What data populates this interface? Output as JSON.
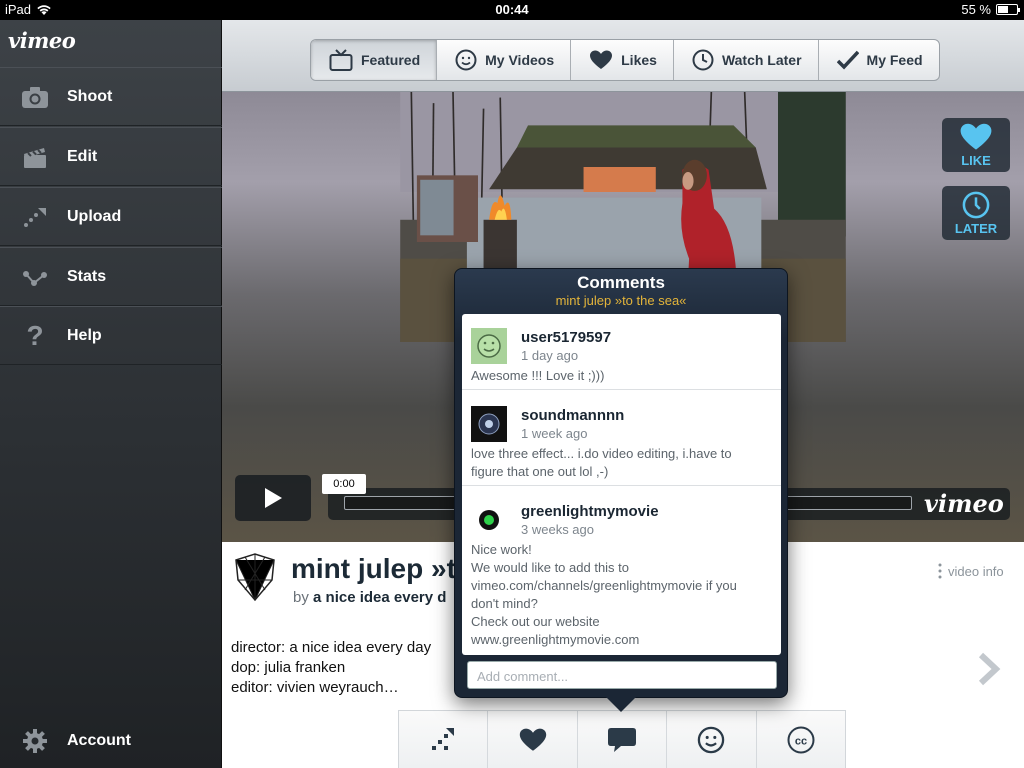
{
  "status_bar": {
    "device": "iPad",
    "time": "00:44",
    "battery_percent": "55 %",
    "battery_level": 0.55
  },
  "sidebar": {
    "logo": "vimeo",
    "items": [
      {
        "label": "Shoot",
        "icon": "camera-icon"
      },
      {
        "label": "Edit",
        "icon": "clapperboard-icon"
      },
      {
        "label": "Upload",
        "icon": "upload-icon"
      },
      {
        "label": "Stats",
        "icon": "stats-icon"
      },
      {
        "label": "Help",
        "icon": "help-icon"
      }
    ],
    "account": {
      "label": "Account",
      "icon": "gear-icon"
    }
  },
  "tabs": [
    {
      "label": "Featured",
      "icon": "tv-icon",
      "active": true
    },
    {
      "label": "My Videos",
      "icon": "smiley-icon",
      "active": false
    },
    {
      "label": "Likes",
      "icon": "heart-icon",
      "active": false
    },
    {
      "label": "Watch Later",
      "icon": "clock-icon",
      "active": false
    },
    {
      "label": "My Feed",
      "icon": "checkmark-icon",
      "active": false
    }
  ],
  "player": {
    "like_label": "LIKE",
    "later_label": "LATER",
    "current_time": "0:00",
    "watermark": "vimeo",
    "accent_color": "#58c4f0"
  },
  "video": {
    "title": "mint julep »to the sea«",
    "title_visible": "mint julep »t",
    "by_prefix": "by",
    "author_visible": "a nice idea every d",
    "info_label": "video info",
    "description": [
      "director: a nice idea every day",
      "dop: julia franken",
      "editor: vivien weyrauch…"
    ]
  },
  "actions": [
    {
      "name": "share",
      "icon": "share-icon"
    },
    {
      "name": "like",
      "icon": "heart-icon"
    },
    {
      "name": "comments",
      "icon": "speech-bubble-icon"
    },
    {
      "name": "user",
      "icon": "smiley-icon"
    },
    {
      "name": "captions",
      "icon": "cc-icon"
    }
  ],
  "comments": {
    "title": "Comments",
    "subtitle": "mint julep »to the sea«",
    "placeholder": "Add comment...",
    "subtitle_color": "#e3b43a",
    "items": [
      {
        "user": "user5179597",
        "time": "1 day ago",
        "lines": [
          "Awesome !!! Love it ;)))"
        ]
      },
      {
        "user": "soundmannnn",
        "time": "1 week ago",
        "lines": [
          "love three effect... i.do video editing, i.have to",
          "figure that one out lol ,-)"
        ]
      },
      {
        "user": "greenlightmymovie",
        "time": "3 weeks ago",
        "lines": [
          "Nice work!",
          "We would like to add this to",
          "vimeo.com/channels/greenlightmymovie if you",
          "don't mind?",
          "Check out our website",
          "www.greenlightmymovie.com"
        ]
      }
    ]
  }
}
